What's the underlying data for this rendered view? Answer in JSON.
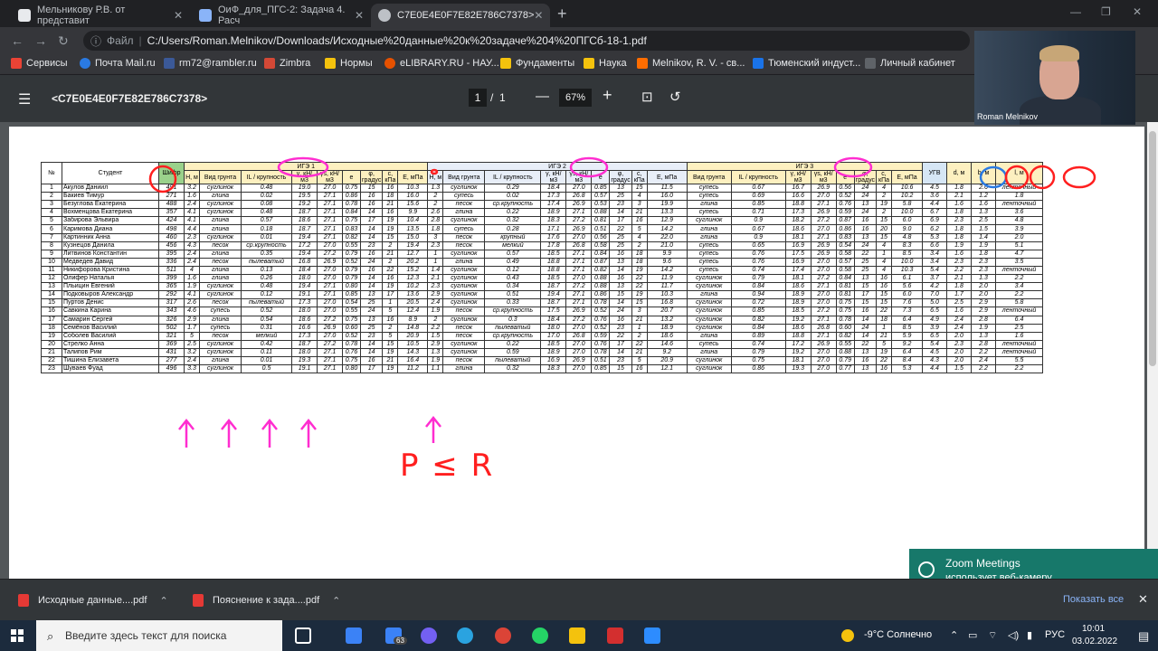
{
  "browser": {
    "tabs": [
      {
        "title": "Мельникову Р.В. от представит",
        "icon_color": "#e8eaed"
      },
      {
        "title": "ОиФ_для_ПГС-2: Задача 4. Расч",
        "icon_color": "#8ab4f8"
      },
      {
        "title": "C7E0E4E0F7E82E786C7378>",
        "icon_color": "#bdc1c6",
        "active": true
      }
    ],
    "address_label": "Файл",
    "url": "C:/Users/Roman.Melnikov/Downloads/Исходные%20данные%20к%20задаче%204%20ПГСб-18-1.pdf",
    "bookmarks": [
      {
        "label": "Сервисы",
        "color": "#ea4335"
      },
      {
        "label": "Почта Mail.ru",
        "color": "#2a7ae2"
      },
      {
        "label": "rm72@rambler.ru",
        "color": "#3b5998"
      },
      {
        "label": "Zimbra",
        "color": "#d34836"
      },
      {
        "label": "Нормы",
        "color": "#f4c20d"
      },
      {
        "label": "eLIBRARY.RU - НАУ...",
        "color": "#e65100"
      },
      {
        "label": "Фундаменты",
        "color": "#f4c20d"
      },
      {
        "label": "Наука",
        "color": "#f4c20d"
      },
      {
        "label": "Melnikov, R. V. - св...",
        "color": "#ff6d00"
      },
      {
        "label": "Тюменский индуст...",
        "color": "#1a73e8"
      },
      {
        "label": "Личный кабинет",
        "color": "#5f6368"
      }
    ]
  },
  "pdf": {
    "title": "<C7E0E4E0F7E82E786C7378>",
    "page_current": "1",
    "page_total": "1",
    "zoom": "67%"
  },
  "table": {
    "groups": [
      "ИГЭ 1",
      "ИГЭ 2",
      "ИГЭ 3"
    ],
    "head": {
      "no": "№",
      "student": "Студент",
      "variant": "Шифр",
      "h": "H, м",
      "soil": "Вид грунта",
      "il": "IL / крупность",
      "gamma": "γ, кН/м3",
      "gammas": "γs, кН/м3",
      "e": "e",
      "phi": "φ, градус",
      "c": "c, кПа",
      "E": "E, мПа",
      "ugv": "УГВ",
      "d": "d, м",
      "b": "b, м",
      "type": "l, м"
    },
    "rows": [
      [
        "1",
        "Акулов Даниил",
        "491",
        "3.2",
        "суглинок",
        "0.48",
        "19.0",
        "27.0",
        "0.75",
        "15",
        "16",
        "10.3",
        "1.3",
        "суглинок",
        "0.29",
        "18.4",
        "27.0",
        "0.85",
        "13",
        "15",
        "11.5",
        "супесь",
        "0.67",
        "16.7",
        "26.9",
        "0.56",
        "24",
        "4",
        "10.6",
        "4.5",
        "1.8",
        "2.6",
        "ленточный"
      ],
      [
        "2",
        "Бакиев Тимур",
        "271",
        "1.6",
        "глина",
        "0.02",
        "19.5",
        "27.1",
        "0.86",
        "16",
        "18",
        "16.0",
        "2",
        "супесь",
        "0.02",
        "17.3",
        "26.8",
        "0.57",
        "25",
        "4",
        "16.0",
        "супесь",
        "0.69",
        "16.6",
        "27.0",
        "0.52",
        "24",
        "2",
        "10.2",
        "3.6",
        "2.1",
        "1.2",
        "1.8"
      ],
      [
        "3",
        "Безуглова Екатерина",
        "488",
        "2.4",
        "суглинок",
        "0.08",
        "19.2",
        "27.1",
        "0.78",
        "16",
        "21",
        "15.6",
        "2",
        "песок",
        "ср.крупность",
        "17.4",
        "26.9",
        "0.53",
        "23",
        "3",
        "19.9",
        "глина",
        "0.85",
        "18.8",
        "27.1",
        "0.76",
        "13",
        "19",
        "5.8",
        "4.4",
        "1.6",
        "1.6",
        "ленточный"
      ],
      [
        "4",
        "Вохменцова Екатерина",
        "357",
        "4.1",
        "суглинок",
        "0.48",
        "18.7",
        "27.1",
        "0.84",
        "14",
        "16",
        "9.9",
        "2.6",
        "глина",
        "0.22",
        "18.9",
        "27.1",
        "0.88",
        "14",
        "21",
        "13.3",
        "супесь",
        "0.71",
        "17.3",
        "26.9",
        "0.59",
        "24",
        "2",
        "10.0",
        "6.7",
        "1.8",
        "1.3",
        "3.6"
      ],
      [
        "5",
        "Забирова Эльвира",
        "424",
        "4.1",
        "глина",
        "0.57",
        "18.6",
        "27.1",
        "0.75",
        "17",
        "19",
        "10.4",
        "2.8",
        "суглинок",
        "0.32",
        "18.3",
        "27.2",
        "0.81",
        "17",
        "16",
        "12.9",
        "суглинок",
        "0.9",
        "18.2",
        "27.2",
        "0.87",
        "16",
        "15",
        "6.0",
        "6.9",
        "2.3",
        "2.5",
        "4.8"
      ],
      [
        "6",
        "Каримова Диана",
        "498",
        "4.4",
        "глина",
        "0.18",
        "18.7",
        "27.1",
        "0.83",
        "14",
        "19",
        "13.5",
        "1.8",
        "супесь",
        "0.28",
        "17.1",
        "26.9",
        "0.51",
        "22",
        "5",
        "14.2",
        "глина",
        "0.67",
        "18.6",
        "27.0",
        "0.86",
        "16",
        "20",
        "9.0",
        "6.2",
        "1.8",
        "1.5",
        "3.9"
      ],
      [
        "7",
        "Картинник Анна",
        "460",
        "2.3",
        "суглинок",
        "0.01",
        "19.4",
        "27.1",
        "0.82",
        "14",
        "15",
        "15.0",
        "3",
        "песок",
        "крупный",
        "17.6",
        "27.0",
        "0.56",
        "25",
        "4",
        "22.0",
        "глина",
        "0.9",
        "18.1",
        "27.1",
        "0.83",
        "13",
        "15",
        "4.8",
        "5.3",
        "1.8",
        "1.4",
        "2.0"
      ],
      [
        "8",
        "Кузнецов Данила",
        "456",
        "4.3",
        "песок",
        "ср.крупность",
        "17.2",
        "27.0",
        "0.55",
        "23",
        "2",
        "19.4",
        "2.3",
        "песок",
        "мелкий",
        "17.8",
        "26.8",
        "0.58",
        "25",
        "2",
        "21.0",
        "супесь",
        "0.65",
        "16.9",
        "26.9",
        "0.54",
        "24",
        "4",
        "8.3",
        "6.6",
        "1.9",
        "1.9",
        "5.1"
      ],
      [
        "9",
        "Литвинов Константин",
        "395",
        "2.4",
        "глина",
        "0.35",
        "19.4",
        "27.2",
        "0.79",
        "16",
        "21",
        "12.7",
        "1",
        "суглинок",
        "0.57",
        "18.5",
        "27.1",
        "0.84",
        "16",
        "18",
        "9.9",
        "супесь",
        "0.76",
        "17.5",
        "26.9",
        "0.58",
        "22",
        "1",
        "8.5",
        "3.4",
        "1.6",
        "1.8",
        "4.7"
      ],
      [
        "10",
        "Медведев Давид",
        "336",
        "2.4",
        "песок",
        "пылеватый",
        "16.8",
        "26.9",
        "0.52",
        "24",
        "2",
        "20.2",
        "1",
        "глина",
        "0.49",
        "18.8",
        "27.1",
        "0.87",
        "13",
        "18",
        "9.6",
        "супесь",
        "0.76",
        "16.9",
        "27.0",
        "0.57",
        "25",
        "4",
        "10.0",
        "3.4",
        "2.3",
        "2.3",
        "3.5"
      ],
      [
        "11",
        "Никифорова Кристина",
        "511",
        "4",
        "глина",
        "0.13",
        "18.4",
        "27.0",
        "0.79",
        "16",
        "22",
        "15.2",
        "1.4",
        "суглинок",
        "0.12",
        "18.8",
        "27.1",
        "0.82",
        "14",
        "19",
        "14.2",
        "супесь",
        "0.74",
        "17.4",
        "27.0",
        "0.58",
        "25",
        "4",
        "10.3",
        "5.4",
        "2.2",
        "2.3",
        "ленточный"
      ],
      [
        "12",
        "Олифер Наталья",
        "399",
        "1.6",
        "глина",
        "0.26",
        "18.0",
        "27.0",
        "0.79",
        "14",
        "16",
        "12.3",
        "2.1",
        "суглинок",
        "0.43",
        "18.5",
        "27.0",
        "0.88",
        "16",
        "22",
        "11.9",
        "суглинок",
        "0.79",
        "18.1",
        "27.2",
        "0.84",
        "13",
        "16",
        "6.1",
        "3.7",
        "2.1",
        "1.3",
        "2.2"
      ],
      [
        "13",
        "Пльицин Евгений",
        "365",
        "1.9",
        "суглинок",
        "0.48",
        "19.4",
        "27.1",
        "0.80",
        "14",
        "19",
        "10.2",
        "2.3",
        "суглинок",
        "0.34",
        "18.7",
        "27.2",
        "0.88",
        "13",
        "22",
        "11.7",
        "суглинок",
        "0.84",
        "18.6",
        "27.1",
        "0.81",
        "15",
        "16",
        "5.6",
        "4.2",
        "1.8",
        "2.0",
        "3.4"
      ],
      [
        "14",
        "Подковыров Александр",
        "292",
        "4.1",
        "суглинок",
        "0.12",
        "19.1",
        "27.1",
        "0.85",
        "13",
        "17",
        "13.6",
        "2.9",
        "суглинок",
        "0.51",
        "19.4",
        "27.1",
        "0.86",
        "15",
        "19",
        "10.3",
        "глина",
        "0.94",
        "18.9",
        "27.0",
        "0.81",
        "17",
        "15",
        "6.0",
        "7.0",
        "1.7",
        "2.0",
        "2.2"
      ],
      [
        "15",
        "Пуртов Денис",
        "317",
        "2.6",
        "песок",
        "пылеватый",
        "17.3",
        "27.0",
        "0.54",
        "25",
        "1",
        "20.5",
        "2.4",
        "суглинок",
        "0.33",
        "18.7",
        "27.1",
        "0.78",
        "14",
        "15",
        "16.8",
        "суглинок",
        "0.72",
        "18.9",
        "27.0",
        "0.75",
        "15",
        "15",
        "7.6",
        "5.0",
        "2.5",
        "2.9",
        "5.8"
      ],
      [
        "16",
        "Савкина Карина",
        "343",
        "4.6",
        "супесь",
        "0.52",
        "18.0",
        "27.0",
        "0.55",
        "24",
        "5",
        "12.4",
        "1.9",
        "песок",
        "ср.крупность",
        "17.5",
        "26.9",
        "0.52",
        "24",
        "3",
        "20.7",
        "суглинок",
        "0.85",
        "18.5",
        "27.2",
        "0.75",
        "16",
        "22",
        "7.3",
        "6.5",
        "1.6",
        "2.9",
        "ленточный"
      ],
      [
        "17",
        "Самарин Сергей",
        "326",
        "2.9",
        "глина",
        "0.54",
        "18.6",
        "27.2",
        "0.75",
        "13",
        "16",
        "8.9",
        "2",
        "суглинок",
        "0.3",
        "18.4",
        "27.2",
        "0.76",
        "16",
        "21",
        "13.2",
        "суглинок",
        "0.82",
        "19.2",
        "27.1",
        "0.78",
        "14",
        "18",
        "6.4",
        "4.9",
        "2.4",
        "2.8",
        "6.4"
      ],
      [
        "18",
        "Семёнов Василий",
        "502",
        "1.7",
        "супесь",
        "0.31",
        "16.6",
        "26.9",
        "0.60",
        "25",
        "2",
        "14.8",
        "2.2",
        "песок",
        "пылеватый",
        "18.0",
        "27.0",
        "0.52",
        "23",
        "1",
        "18.9",
        "суглинок",
        "0.84",
        "18.6",
        "26.8",
        "0.60",
        "24",
        "1",
        "8.5",
        "3.9",
        "2.4",
        "1.9",
        "2.5"
      ],
      [
        "19",
        "Соболев Василий",
        "321",
        "5",
        "песок",
        "мелкий",
        "17.3",
        "27.0",
        "0.52",
        "23",
        "5",
        "20.9",
        "1.5",
        "песок",
        "ср.крупность",
        "17.0",
        "26.8",
        "0.59",
        "22",
        "2",
        "18.6",
        "глина",
        "0.89",
        "18.8",
        "27.1",
        "0.82",
        "14",
        "21",
        "5.9",
        "6.5",
        "2.0",
        "1.3",
        "1.6"
      ],
      [
        "20",
        "Стрелко Анна",
        "369",
        "2.5",
        "суглинок",
        "0.42",
        "18.7",
        "27.2",
        "0.78",
        "14",
        "15",
        "10.5",
        "2.9",
        "суглинок",
        "0.22",
        "18.5",
        "27.0",
        "0.76",
        "17",
        "22",
        "14.6",
        "супесь",
        "0.74",
        "17.2",
        "26.9",
        "0.55",
        "22",
        "5",
        "9.2",
        "5.4",
        "2.3",
        "2.8",
        "ленточный"
      ],
      [
        "21",
        "Талипов Рим",
        "431",
        "3.2",
        "суглинок",
        "0.11",
        "18.0",
        "27.1",
        "0.76",
        "14",
        "19",
        "14.3",
        "1.3",
        "суглинок",
        "0.59",
        "18.9",
        "27.0",
        "0.78",
        "14",
        "21",
        "9.2",
        "глина",
        "0.79",
        "19.2",
        "27.0",
        "0.88",
        "13",
        "19",
        "6.4",
        "4.5",
        "2.0",
        "2.2",
        "ленточный"
      ],
      [
        "22",
        "Тишина Елизавета",
        "277",
        "2.4",
        "глина",
        "0.01",
        "19.3",
        "27.1",
        "0.75",
        "16",
        "21",
        "16.4",
        "1.9",
        "песок",
        "пылеватый",
        "16.9",
        "26.9",
        "0.51",
        "23",
        "5",
        "20.9",
        "суглинок",
        "0.75",
        "18.1",
        "27.0",
        "0.79",
        "16",
        "22",
        "8.4",
        "4.3",
        "2.0",
        "2.4",
        "5.5"
      ],
      [
        "23",
        "Шуваев Фуад",
        "496",
        "3.3",
        "суглинок",
        "0.5",
        "19.1",
        "27.1",
        "0.80",
        "17",
        "19",
        "11.2",
        "1.1",
        "глина",
        "0.32",
        "18.3",
        "27.0",
        "0.85",
        "15",
        "16",
        "12.1",
        "суглинок",
        "0.86",
        "19.3",
        "27.0",
        "0.77",
        "13",
        "16",
        "5.3",
        "4.4",
        "1.5",
        "2.2",
        "2.2"
      ]
    ]
  },
  "handwriting": {
    "formula": "P ≤ R"
  },
  "downloads": {
    "items": [
      "Исходные данные....pdf",
      "Пояснение к зада....pdf"
    ],
    "show_all": "Показать все"
  },
  "zoom_popup": {
    "title": "Zoom Meetings",
    "subtitle": "использует веб-камеру"
  },
  "webcam": {
    "name": "Roman Melnikov"
  },
  "taskbar": {
    "search_placeholder": "Введите здесь текст для поиска",
    "badge": "63",
    "weather": "-9°C  Солнечно",
    "lang": "РУС",
    "time": "10:01",
    "date": "03.02.2022"
  }
}
